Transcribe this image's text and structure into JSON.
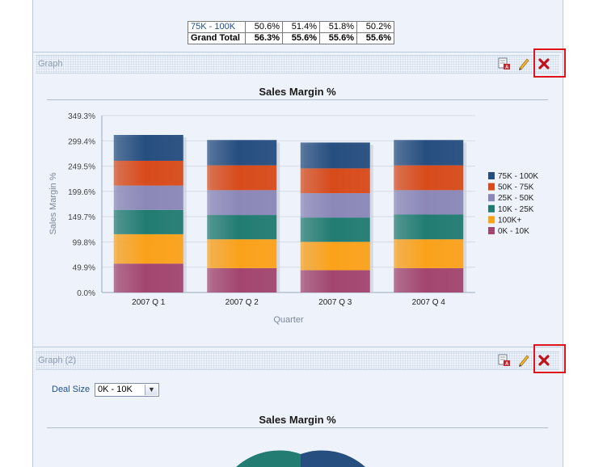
{
  "summary_table": {
    "rows": [
      {
        "label": "75K - 100K",
        "values": [
          "50.6%",
          "51.4%",
          "51.8%",
          "50.2%"
        ]
      },
      {
        "label": "Grand Total",
        "values": [
          "56.3%",
          "55.6%",
          "55.6%",
          "55.6%"
        ]
      }
    ]
  },
  "graph_panel": {
    "title": "Graph",
    "tools": {
      "export_icon": "export-pdf-icon",
      "edit_icon": "pencil-icon",
      "close_icon": "close-x-icon"
    }
  },
  "graph2_panel": {
    "title": "Graph (2)",
    "deal_size_label": "Deal Size",
    "deal_size_value": "0K - 10K",
    "chart_title": "Sales Margin %"
  },
  "colors": {
    "highlight": "#e0121b",
    "seg_0K_10K": "#a3466f",
    "seg_100K_plus": "#fba21b",
    "seg_10K_25K": "#227c72",
    "seg_25K_50K": "#8b88b8",
    "seg_50K_75K": "#d84b1b",
    "seg_75K_100K": "#264e7f"
  },
  "chart_data": {
    "type": "bar",
    "stacked": true,
    "title": "Sales Margin %",
    "xlabel": "Quarter",
    "ylabel": "Sales Margin %",
    "categories": [
      "2007 Q 1",
      "2007 Q 2",
      "2007 Q 3",
      "2007 Q 4"
    ],
    "ylim": [
      0,
      349.3
    ],
    "yticks": [
      "0.0%",
      "49.9%",
      "99.8%",
      "149.7%",
      "199.6%",
      "249.5%",
      "299.4%",
      "349.3%"
    ],
    "grid": true,
    "legend_position": "right",
    "legend": [
      "75K - 100K",
      "50K - 75K",
      "25K - 50K",
      "10K - 25K",
      "100K+",
      "0K - 10K"
    ],
    "series": [
      {
        "name": "0K - 10K",
        "color_key": "seg_0K_10K",
        "values": [
          57,
          48,
          44,
          48
        ]
      },
      {
        "name": "100K+",
        "color_key": "seg_100K_plus",
        "values": [
          58,
          57,
          56,
          57
        ]
      },
      {
        "name": "10K - 25K",
        "color_key": "seg_10K_25K",
        "values": [
          48,
          48,
          48,
          49
        ]
      },
      {
        "name": "25K - 50K",
        "color_key": "seg_25K_50K",
        "values": [
          48,
          49,
          48,
          48
        ]
      },
      {
        "name": "50K - 75K",
        "color_key": "seg_50K_75K",
        "values": [
          49,
          49,
          49,
          49
        ]
      },
      {
        "name": "75K - 100K",
        "color_key": "seg_75K_100K",
        "values": [
          51,
          50,
          51,
          50
        ]
      }
    ]
  }
}
